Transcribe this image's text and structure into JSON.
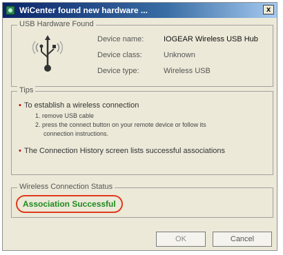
{
  "window": {
    "title": "WiCenter found new hardware ...",
    "close_label": "x"
  },
  "usb_group": {
    "label": "USB Hardware Found",
    "device_name_label": "Device name:",
    "device_name_value": "IOGEAR Wireless USB Hub",
    "device_class_label": "Device class:",
    "device_class_value": "Unknown",
    "device_type_label": "Device type:",
    "device_type_value": "Wireless USB"
  },
  "tips": {
    "label": "Tips",
    "tip1": "To establish a wireless connection",
    "step1": "1. remove USB cable",
    "step2_line1": "2. press the connect button on your remote device or follow its",
    "step2_line2": "connection instructions.",
    "tip2": "The Connection History screen lists successful associations"
  },
  "status": {
    "label": "Wireless Connection Status",
    "text": "Association Successful",
    "highlight_color": "#e03a1c",
    "text_color": "#1f8a1f"
  },
  "buttons": {
    "ok": "OK",
    "cancel": "Cancel"
  },
  "icons": {
    "app_icon": "wicenter-app-icon",
    "usb_icon": "usb-wireless-icon"
  }
}
